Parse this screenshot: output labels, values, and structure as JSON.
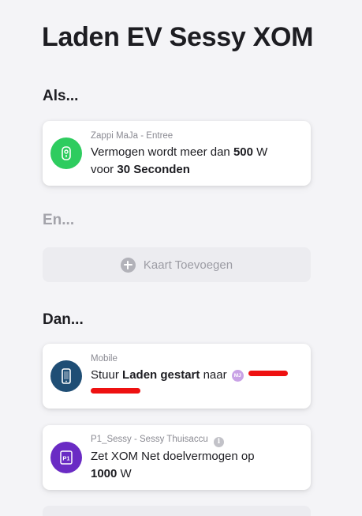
{
  "page_title": "Laden EV Sessy XOM",
  "sections": {
    "if": "Als...",
    "and": "En...",
    "then": "Dan..."
  },
  "trigger_card": {
    "device": "Zappi MaJa - Entree",
    "line1_prefix": "Vermogen wordt meer dan",
    "line1_value": "500",
    "line1_unit": "W",
    "line2_prefix": "voor",
    "line2_value": "30",
    "line2_unit": "Seconden",
    "icon": "zappi-charger-icon",
    "icon_color": "#2ecc5f"
  },
  "add_card": {
    "label": "Kaart Toevoegen",
    "icon": "plus-circle-icon"
  },
  "action_cards": [
    {
      "device": "Mobile",
      "prefix": "Stuur",
      "message": "Laden gestart",
      "connector": "naar",
      "avatar_initials": "MJ",
      "icon": "mobile-phone-icon",
      "icon_color": "#1f4e75"
    },
    {
      "device": "P1_Sessy - Sessy Thuisaccu",
      "line1": "Zet XOM Net doelvermogen op",
      "value": "1000",
      "unit": "W",
      "icon": "p1-meter-icon",
      "icon_label": "P1",
      "icon_color": "#6a2bc4"
    }
  ],
  "colors": {
    "background": "#f4f4f7",
    "redaction": "#ee1111"
  }
}
